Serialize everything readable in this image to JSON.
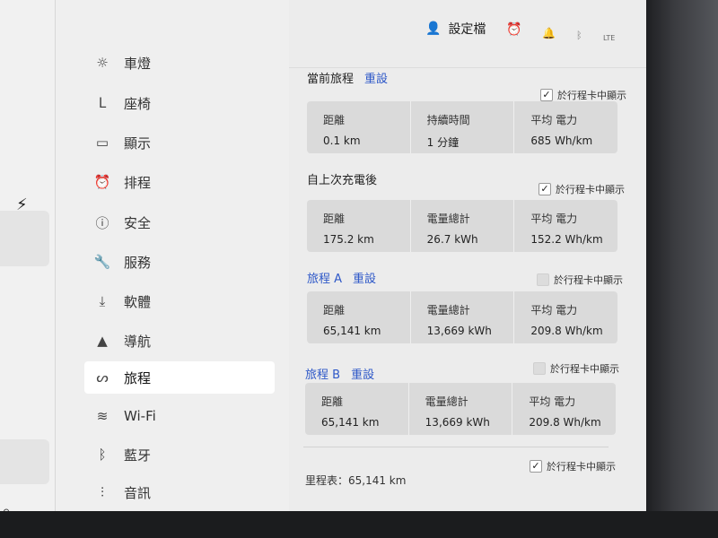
{
  "header": {
    "profile_label": "設定檔",
    "network_label": "LTE"
  },
  "sidebar": {
    "items": [
      {
        "label": "車燈",
        "icon": "sun-icon"
      },
      {
        "label": "座椅",
        "icon": "seat-icon"
      },
      {
        "label": "顯示",
        "icon": "display-icon"
      },
      {
        "label": "排程",
        "icon": "alarm-clock-icon"
      },
      {
        "label": "安全",
        "icon": "alert-icon"
      },
      {
        "label": "服務",
        "icon": "wrench-icon"
      },
      {
        "label": "軟體",
        "icon": "download-icon"
      },
      {
        "label": "導航",
        "icon": "navigation-arrow-icon"
      },
      {
        "label": "旅程",
        "icon": "trip-icon",
        "active": true
      },
      {
        "label": "Wi-Fi",
        "icon": "wifi-icon"
      },
      {
        "label": "藍牙",
        "icon": "bluetooth-icon"
      },
      {
        "label": "音訊",
        "icon": "audio-sliders-icon"
      }
    ]
  },
  "trips": {
    "current": {
      "title": "當前旅程",
      "reset": "重設",
      "show_on_card": "於行程卡中顯示",
      "checked": true,
      "cells": [
        {
          "label": "距離",
          "value": "0.1 km"
        },
        {
          "label": "持續時間",
          "value": "1 分鐘"
        },
        {
          "label": "平均 電力",
          "value": "685 Wh/km"
        }
      ]
    },
    "since_charge": {
      "title": "自上次充電後",
      "show_on_card": "於行程卡中顯示",
      "checked": true,
      "cells": [
        {
          "label": "距離",
          "value": "175.2 km"
        },
        {
          "label": "電量總計",
          "value": "26.7 kWh"
        },
        {
          "label": "平均 電力",
          "value": "152.2 Wh/km"
        }
      ]
    },
    "trip_a": {
      "title": "旅程 A",
      "reset": "重設",
      "show_on_card": "於行程卡中顯示",
      "checked": false,
      "cells": [
        {
          "label": "距離",
          "value": "65,141 km"
        },
        {
          "label": "電量總計",
          "value": "13,669 kWh"
        },
        {
          "label": "平均 電力",
          "value": "209.8 Wh/km"
        }
      ]
    },
    "trip_b": {
      "title": "旅程 B",
      "reset": "重設",
      "show_on_card": "於行程卡中顯示",
      "checked": false,
      "cells": [
        {
          "label": "距離",
          "value": "65,141 km"
        },
        {
          "label": "電量總計",
          "value": "13,669 kWh"
        },
        {
          "label": "平均 電力",
          "value": "209.8 Wh/km"
        }
      ]
    }
  },
  "odometer": {
    "text": "里程表：65,141 km",
    "show_on_card": "於行程卡中顯示",
    "checked": true
  },
  "colors": {
    "accent": "#2e58c8",
    "alarm": "#e59a2c"
  }
}
